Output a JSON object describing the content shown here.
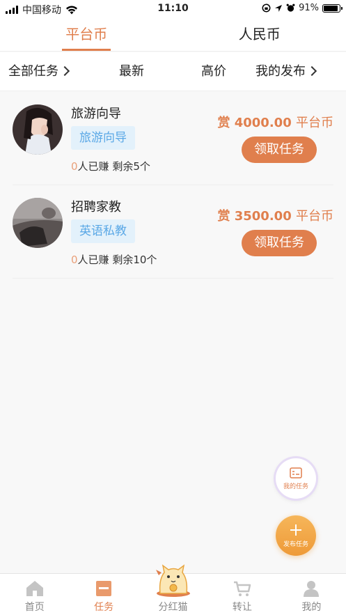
{
  "status_bar": {
    "carrier": "中国移动",
    "time": "11:10",
    "battery": "91%",
    "battery_level": 0.91
  },
  "currency_tabs": [
    {
      "label": "平台币",
      "active": true
    },
    {
      "label": "人民币",
      "active": false
    }
  ],
  "filters": {
    "all_tasks": "全部任务",
    "newest": "最新",
    "high_price": "高价",
    "my_posts": "我的发布"
  },
  "tasks": [
    {
      "title": "旅游向导",
      "tag": "旅游向导",
      "earned_count": "0",
      "stats_text": "人已赚 剩余5个",
      "reward_prefix": "赏",
      "reward_amount": "4000.00",
      "reward_unit": "平台币",
      "button": "领取任务"
    },
    {
      "title": "招聘家教",
      "tag": "英语私教",
      "earned_count": "0",
      "stats_text": "人已赚 剩余10个",
      "reward_prefix": "赏",
      "reward_amount": "3500.00",
      "reward_unit": "平台币",
      "button": "领取任务"
    }
  ],
  "fabs": {
    "my_tasks": "我的任务",
    "post_task": "发布任务"
  },
  "bottom_nav": [
    {
      "label": "首页",
      "icon": "home-icon",
      "active": false
    },
    {
      "label": "任务",
      "icon": "task-icon",
      "active": true
    },
    {
      "label": "分红猫",
      "icon": "lucky-cat-icon",
      "active": false
    },
    {
      "label": "转让",
      "icon": "cart-icon",
      "active": false
    },
    {
      "label": "我的",
      "icon": "user-icon",
      "active": false
    }
  ],
  "colors": {
    "accent": "#e07f4d",
    "tag_text": "#5aa8e6",
    "tag_bg": "#e3f1fb",
    "fab_orange": "#ee9a38"
  }
}
